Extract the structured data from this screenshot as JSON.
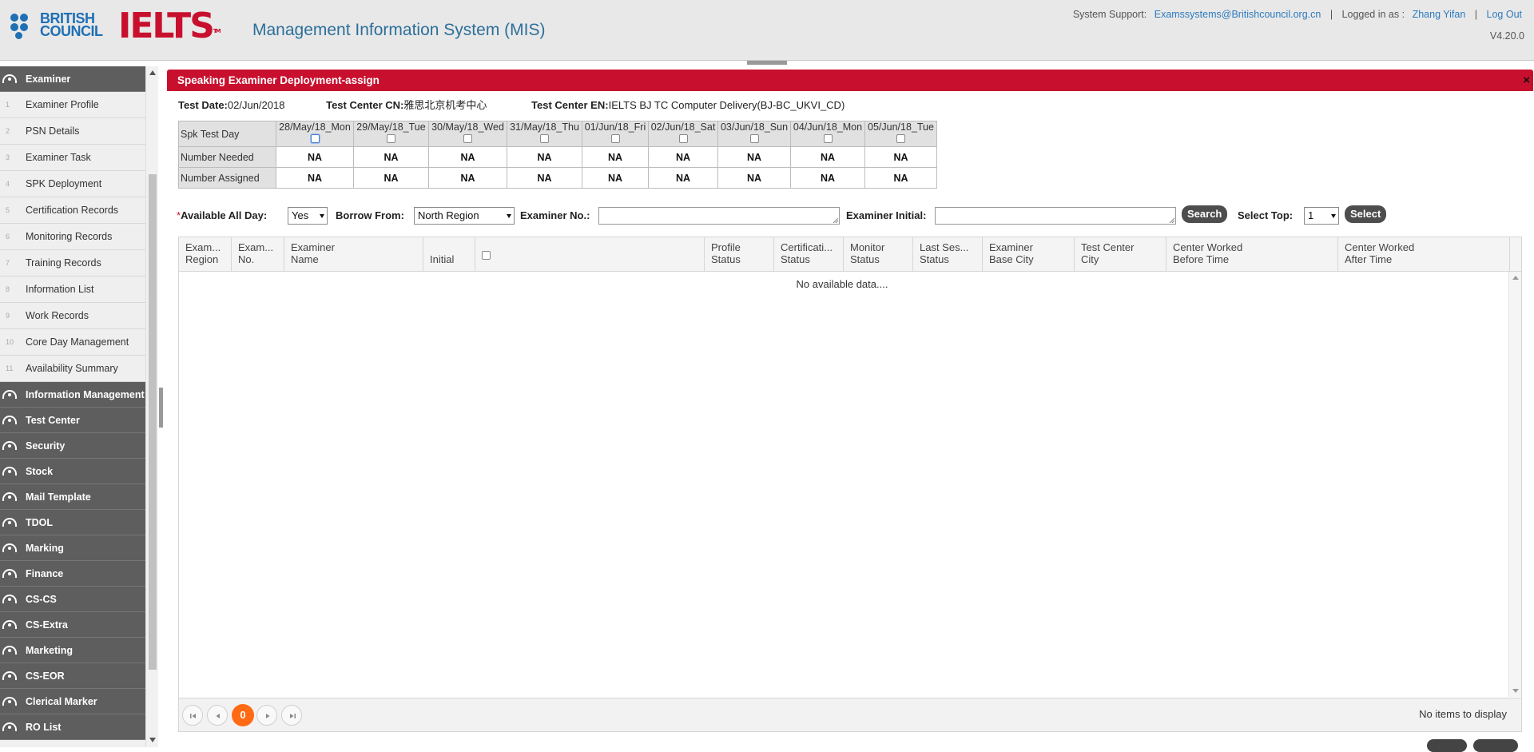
{
  "header": {
    "brand_line1": "BRITISH",
    "brand_line2": "COUNCIL",
    "ielts": "IELTS",
    "ielts_tm": "TM",
    "title": "Management Information System (MIS)",
    "support_label": "System Support:",
    "support_email": "Examssystems@Britishcouncil.org.cn",
    "sep": "|",
    "logged_label": "Logged in as :",
    "user": "Zhang Yifan",
    "logout": "Log Out",
    "version": "V4.20.0"
  },
  "sidebar": {
    "examiner_group": "Examiner",
    "items": [
      {
        "num": "1",
        "label": "Examiner Profile"
      },
      {
        "num": "2",
        "label": "PSN Details"
      },
      {
        "num": "3",
        "label": "Examiner Task"
      },
      {
        "num": "4",
        "label": "SPK Deployment"
      },
      {
        "num": "5",
        "label": "Certification Records"
      },
      {
        "num": "6",
        "label": "Monitoring Records"
      },
      {
        "num": "7",
        "label": "Training Records"
      },
      {
        "num": "8",
        "label": "Information List"
      },
      {
        "num": "9",
        "label": "Work Records"
      },
      {
        "num": "10",
        "label": "Core Day Management"
      },
      {
        "num": "11",
        "label": "Availability Summary"
      }
    ],
    "groups": [
      "Information Management",
      "Test Center",
      "Security",
      "Stock",
      "Mail Template",
      "TDOL",
      "Marking",
      "Finance",
      "CS-CS",
      "CS-Extra",
      "Marketing",
      "CS-EOR",
      "Clerical Marker",
      "RO List"
    ]
  },
  "panel": {
    "title": "Speaking Examiner Deployment-assign",
    "close": "×",
    "test_date_label": "Test Date:",
    "test_date": "02/Jun/2018",
    "cn_label": "Test Center CN:",
    "cn_value": "雅思北京机考中心",
    "en_label": "Test Center EN:",
    "en_value": "IELTS BJ TC Computer Delivery(BJ-BC_UKVI_CD)"
  },
  "day_table": {
    "row_header": "Spk Test Day",
    "needed_label": "Number Needed",
    "assigned_label": "Number Assigned",
    "days": [
      "28/May/18_Mon",
      "29/May/18_Tue",
      "30/May/18_Wed",
      "31/May/18_Thu",
      "01/Jun/18_Fri",
      "02/Jun/18_Sat",
      "03/Jun/18_Sun",
      "04/Jun/18_Mon",
      "05/Jun/18_Tue"
    ],
    "needed": [
      "NA",
      "NA",
      "NA",
      "NA",
      "NA",
      "NA",
      "NA",
      "NA",
      "NA"
    ],
    "assigned": [
      "NA",
      "NA",
      "NA",
      "NA",
      "NA",
      "NA",
      "NA",
      "NA",
      "NA"
    ]
  },
  "filters": {
    "required_mark": "*",
    "available_label": "Available All Day:",
    "available_value": "Yes",
    "borrow_label": "Borrow From:",
    "borrow_value": "North Region",
    "exam_no_label": "Examiner No.:",
    "exam_no_value": "",
    "initial_label": "Examiner Initial:",
    "initial_value": "",
    "search_button": "Search",
    "top_label": "Select Top:",
    "top_value": "1",
    "select_button": "Select"
  },
  "grid": {
    "columns": [
      {
        "l1": "Exam...",
        "l2": "Region"
      },
      {
        "l1": "Exam...",
        "l2": "No."
      },
      {
        "l1": "Examiner",
        "l2": "Name"
      },
      {
        "l1": "",
        "l2": "Initial"
      },
      {
        "l1": "",
        "l2": ""
      },
      {
        "l1": "Profile",
        "l2": "Status"
      },
      {
        "l1": "Certificati...",
        "l2": "Status"
      },
      {
        "l1": "Monitor",
        "l2": "Status"
      },
      {
        "l1": "Last Ses...",
        "l2": "Status"
      },
      {
        "l1": "Examiner",
        "l2": "Base City"
      },
      {
        "l1": "Test Center",
        "l2": "City"
      },
      {
        "l1": "Center Worked",
        "l2": "Before Time"
      },
      {
        "l1": "Center Worked",
        "l2": "After Time"
      }
    ],
    "no_data": "No available data....",
    "current_page": "0",
    "pager_info": "No items to display"
  }
}
